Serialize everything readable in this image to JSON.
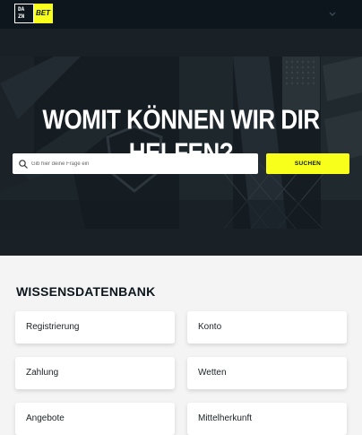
{
  "header": {
    "logo_text": {
      "d": "DA",
      "z": "ZN",
      "bet": "BET"
    },
    "menu_icon": "chevron-down-icon"
  },
  "hero": {
    "title": "WOMIT KÖNNEN WIR DIR HELFEN?",
    "search_placeholder": "Gib hier deine Frage ein",
    "search_button": "SUCHEN"
  },
  "knowledge_base": {
    "title": "WISSENSDATENBANK",
    "categories": [
      "Registrierung",
      "Konto",
      "Zahlung",
      "Wetten",
      "Angebote",
      "Mittelherkunft"
    ]
  },
  "colors": {
    "brand_yellow": "#f7ff1a",
    "header_dark": "#0c161c",
    "page_bg": "#f4f4f4"
  }
}
